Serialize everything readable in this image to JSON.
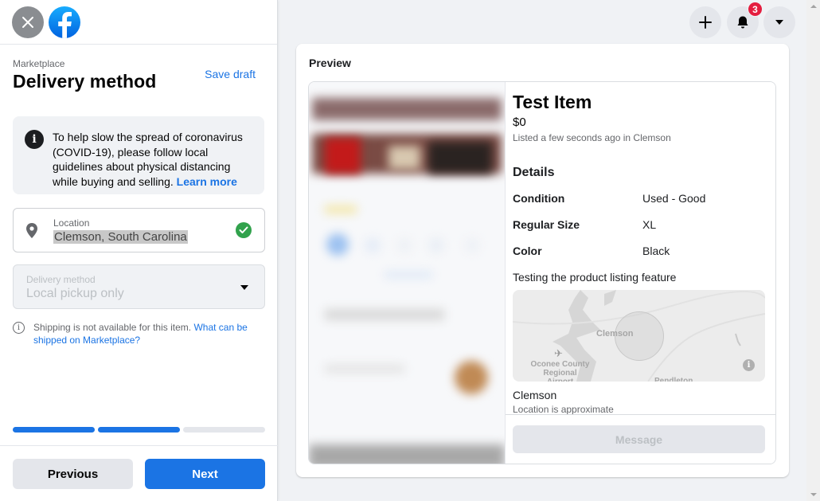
{
  "topbar": {
    "close_icon": "close-icon",
    "logo_icon": "facebook-logo-icon"
  },
  "header": {
    "breadcrumb": "Marketplace",
    "title": "Delivery method",
    "save_draft": "Save draft"
  },
  "notice": {
    "icon": "info-icon",
    "text": "To help slow the spread of coronavirus (COVID-19), please follow local guidelines about physical distancing while buying and selling.",
    "link": "Learn more"
  },
  "location": {
    "label": "Location",
    "value": "Clemson, South Carolina",
    "status": "valid"
  },
  "delivery": {
    "label": "Delivery method",
    "value": "Local pickup only",
    "disabled": true
  },
  "shipping_note": {
    "text": "Shipping is not available for this item.",
    "link": "What can be shipped on Marketplace?"
  },
  "progress": {
    "steps_total": 3,
    "steps_completed": 2
  },
  "footer": {
    "previous": "Previous",
    "next": "Next"
  },
  "top_icons": {
    "create": "plus-icon",
    "notifications": "bell-icon",
    "notifications_badge": "3",
    "account": "caret-down-icon"
  },
  "preview": {
    "heading": "Preview",
    "title": "Test Item",
    "price": "$0",
    "listed": "Listed a few seconds ago in Clemson",
    "details_heading": "Details",
    "details": [
      {
        "key": "Condition",
        "value": "Used - Good"
      },
      {
        "key": "Regular Size",
        "value": "XL"
      },
      {
        "key": "Color",
        "value": "Black"
      }
    ],
    "description": "Testing the product listing feature",
    "map_labels": {
      "city": "Clemson",
      "airport": "Oconee County Regional Airport",
      "town": "Pendleton"
    },
    "location_name": "Clemson",
    "location_note": "Location is approximate",
    "message_button": "Message"
  },
  "colors": {
    "accent": "#1b74e4",
    "success": "#31a24c",
    "badge": "#e41e3f"
  }
}
